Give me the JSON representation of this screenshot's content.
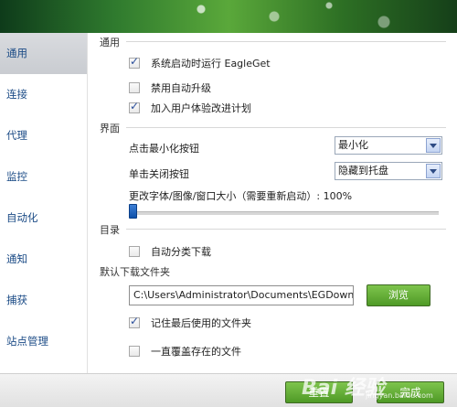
{
  "sidebar": {
    "items": [
      {
        "label": "通用"
      },
      {
        "label": "连接"
      },
      {
        "label": "代理"
      },
      {
        "label": "监控"
      },
      {
        "label": "自动化"
      },
      {
        "label": "通知"
      },
      {
        "label": "捕获"
      },
      {
        "label": "站点管理"
      }
    ],
    "active_index": 0
  },
  "general": {
    "title": "通用",
    "startup_label": "系统启动时运行 EagleGet",
    "startup_checked": true,
    "disable_update_label": "禁用自动升级",
    "disable_update_checked": false,
    "ux_program_label": "加入用户体验改进计划",
    "ux_program_checked": true
  },
  "interface": {
    "title": "界面",
    "minimize_label": "点击最小化按钮",
    "minimize_value": "最小化",
    "close_label": "单击关闭按钮",
    "close_value": "隐藏到托盘",
    "scale_label": "更改字体/图像/窗口大小（需要重新启动）: 100%",
    "scale_percent": 100,
    "slider_position": 0
  },
  "directory": {
    "title": "目录",
    "auto_categorize_label": "自动分类下载",
    "auto_categorize_checked": false,
    "default_folder_label": "默认下载文件夹",
    "default_folder_value": "C:\\Users\\Administrator\\Documents\\EGDownlo",
    "browse_label": "浏览",
    "remember_last_label": "记住最后使用的文件夹",
    "remember_last_checked": true,
    "overwrite_label": "一直覆盖存在的文件",
    "overwrite_checked": false
  },
  "footer": {
    "reset_label": "重置",
    "finish_label": "完成"
  },
  "watermark": {
    "main": "Bai 经验",
    "sub": "jingyan.baidu.com"
  },
  "colors": {
    "accent_green": "#5aa83a",
    "link_blue": "#1b4b86",
    "slider_blue": "#0d4fa8"
  }
}
